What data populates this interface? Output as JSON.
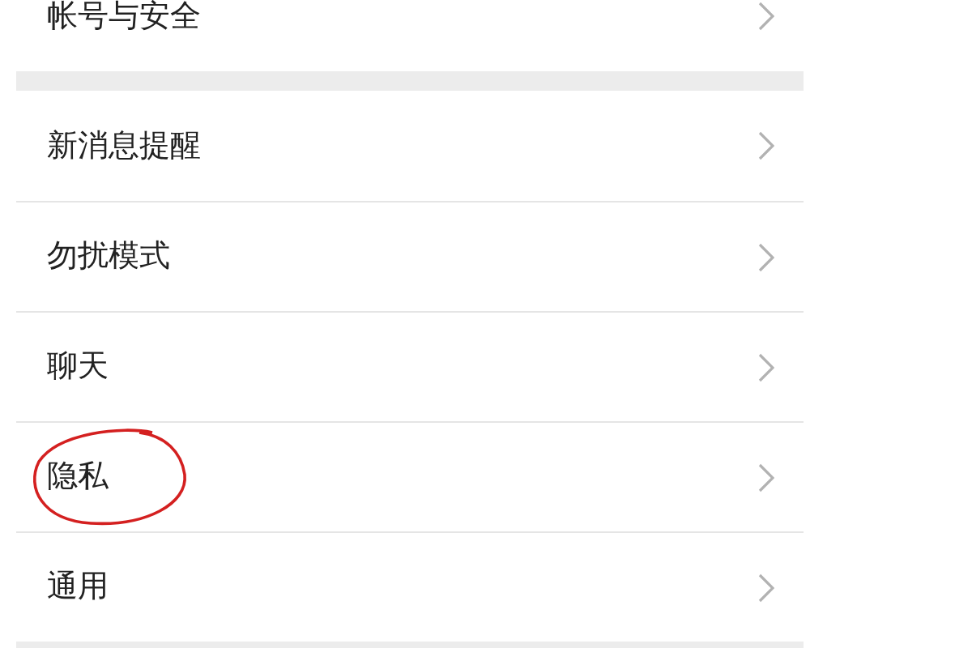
{
  "sections": [
    {
      "items": [
        {
          "label": "帐号与安全",
          "circled": false
        }
      ]
    },
    {
      "items": [
        {
          "label": "新消息提醒",
          "circled": false
        },
        {
          "label": "勿扰模式",
          "circled": false
        },
        {
          "label": "聊天",
          "circled": false
        },
        {
          "label": "隐私",
          "circled": true
        },
        {
          "label": "通用",
          "circled": false
        }
      ]
    }
  ]
}
